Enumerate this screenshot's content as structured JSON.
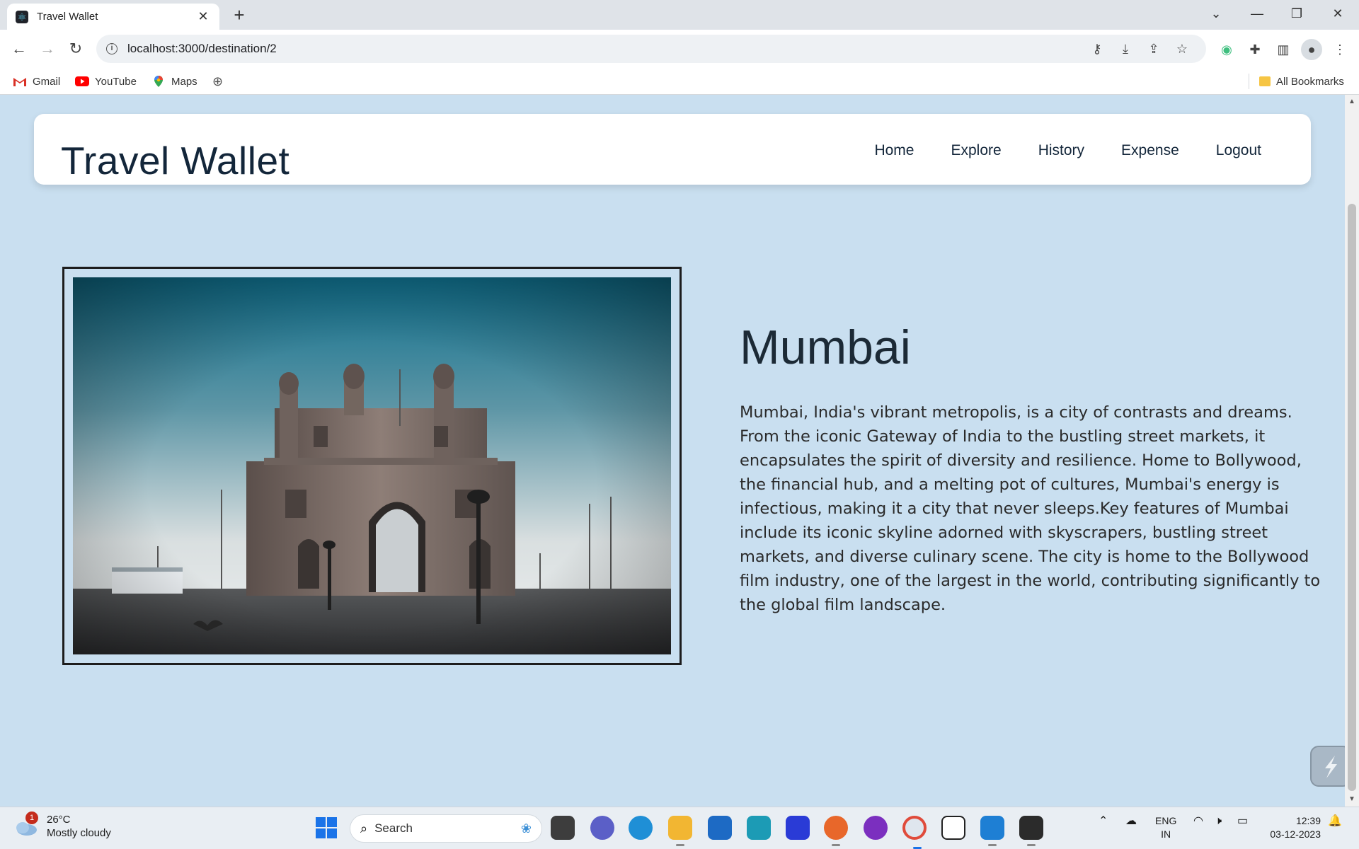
{
  "browser": {
    "tab_title": "Travel Wallet",
    "url": "localhost:3000/destination/2",
    "bookmarks": [
      {
        "label": "Gmail"
      },
      {
        "label": "YouTube"
      },
      {
        "label": "Maps"
      }
    ],
    "all_bookmarks_label": "All Bookmarks"
  },
  "header": {
    "brand": "Travel Wallet",
    "nav": [
      "Home",
      "Explore",
      "History",
      "Expense",
      "Logout"
    ]
  },
  "destination": {
    "title": "Mumbai",
    "description": "Mumbai, India's vibrant metropolis, is a city of contrasts and dreams. From the iconic Gateway of India to the bustling street markets, it encapsulates the spirit of diversity and resilience. Home to Bollywood, the financial hub, and a melting pot of cultures, Mumbai's energy is infectious, making it a city that never sleeps.Key features of Mumbai include its iconic skyline adorned with skyscrapers, bustling street markets, and diverse culinary scene. The city is home to the Bollywood film industry, one of the largest in the world, contributing significantly to the global film landscape."
  },
  "taskbar": {
    "weather_temp": "26°C",
    "weather_desc": "Mostly cloudy",
    "weather_badge": "1",
    "search_label": "Search",
    "lang_line1": "ENG",
    "lang_line2": "IN",
    "time": "12:39",
    "date": "03-12-2023"
  },
  "colors": {
    "page_bg": "#c9dff0",
    "brand_text": "#13263a"
  }
}
